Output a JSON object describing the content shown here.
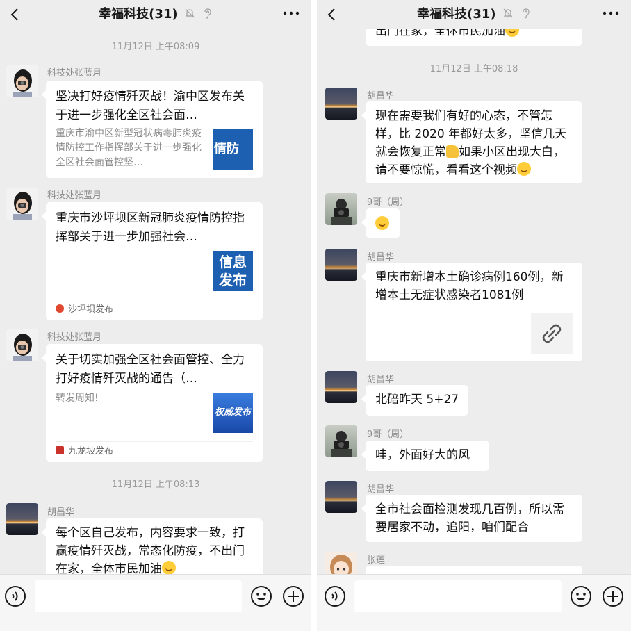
{
  "left": {
    "header": {
      "title": "幸福科技(31)"
    },
    "timestamps": [
      "11月12日 上午08:09",
      "11月12日 上午08:13"
    ],
    "messages": [
      {
        "sender": "科技处张蓝月",
        "title": "坚决打好疫情歼灭战！渝中区发布关于进一步强化全区社会面…",
        "desc": "重庆市渝中区新型冠状病毒肺炎疫情防控工作指挥部关于进一步强化全区社会面管控坚…",
        "thumb_text": "情防"
      },
      {
        "sender": "科技处张蓝月",
        "title": "重庆市沙坪坝区新冠肺炎疫情防控指挥部关于进一步加强社会…",
        "thumb_text": "信息发布",
        "source": "沙坪坝发布"
      },
      {
        "sender": "科技处张蓝月",
        "title": "关于切实加强全区社会面管控、全力打好疫情歼灭战的通告（…",
        "desc": "转发周知!",
        "thumb_text": "权威发布",
        "source": "九龙坡发布"
      },
      {
        "sender": "胡昌华",
        "text": "每个区自己发布，内容要求一致，打赢疫情歼灭战，常态化防疫，不出门在家，全体市民加油"
      }
    ]
  },
  "right": {
    "header": {
      "title": "幸福科技(31)"
    },
    "clipped_text": "出门在家，全体市民加油",
    "timestamps": [
      "11月12日 上午08:18"
    ],
    "messages": [
      {
        "sender": "胡昌华",
        "text_a": "现在需要我们有好的心态，不管怎样，比 2020 年都好太多，坚信几天就会恢复正常",
        "text_b": "如果小区出现大白，请不要惊慌，看看这个视频"
      },
      {
        "sender": "9哥（周）"
      },
      {
        "sender": "胡昌华",
        "text": "重庆市新增本土确诊病例160例，新增本土无症状感染者1081例"
      },
      {
        "sender": "胡昌华",
        "text": "北碚昨天 5+27"
      },
      {
        "sender": "9哥（周）",
        "text": "哇，外面好大的风"
      },
      {
        "sender": "胡昌华",
        "text": "全市社会面检测发现几百例，所以需要居家不动，追阳，咱们配合"
      },
      {
        "sender": "张莲"
      }
    ]
  },
  "colors": {
    "background": "#ededed",
    "bubble": "#ffffff",
    "timestamp": "#9a9a9a",
    "thumb_blue": "#1d5fb0"
  },
  "icons": [
    "back-icon",
    "mute-icon",
    "ear-icon",
    "more-icon",
    "voice-icon",
    "emoji-icon",
    "plus-icon",
    "link-icon"
  ]
}
